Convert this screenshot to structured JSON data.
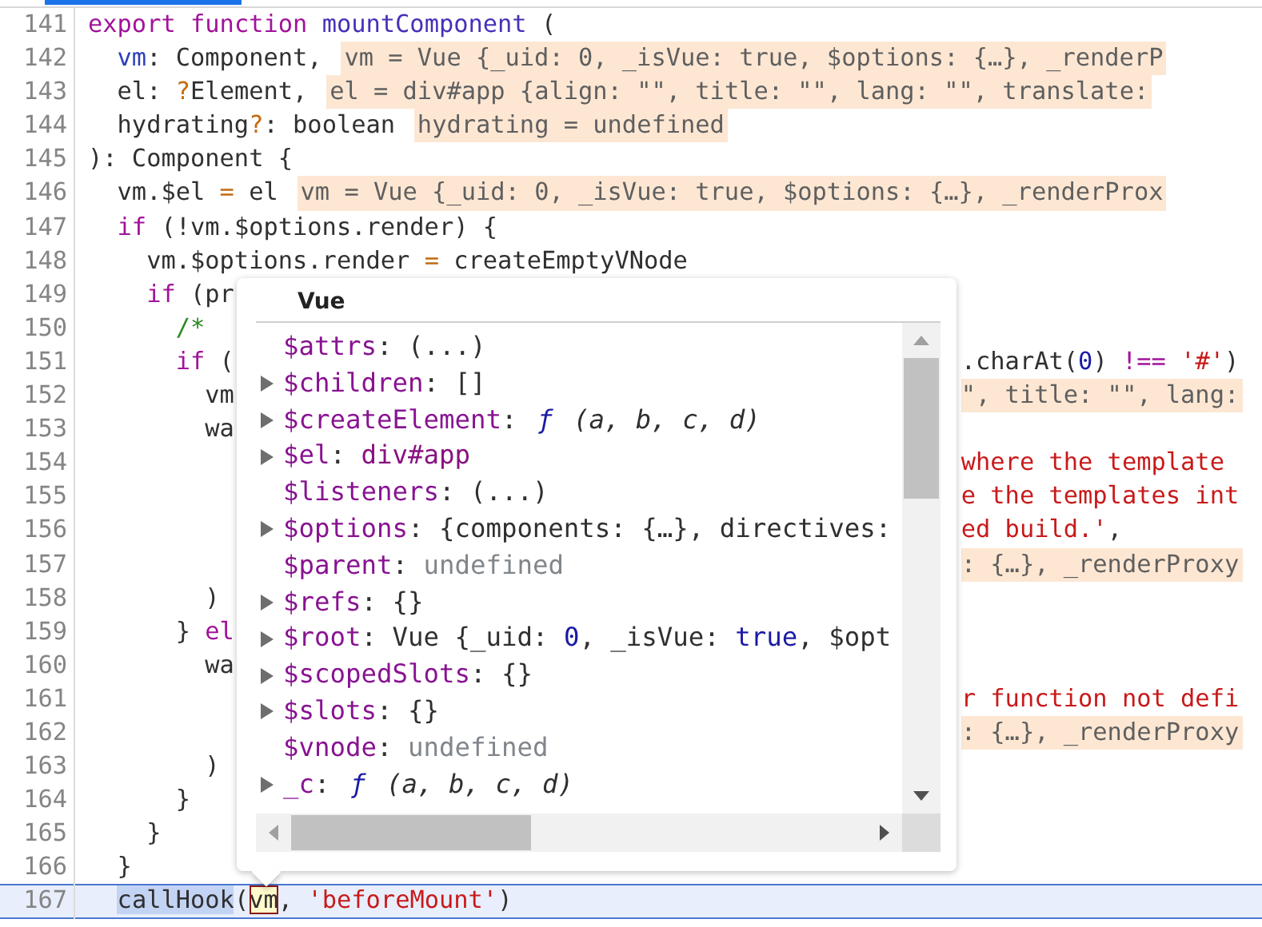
{
  "editor": {
    "lines": [
      {
        "number": "141",
        "current": false,
        "left": [
          {
            "kind": "code",
            "tokens": [
              {
                "kind": "keyword",
                "text": "export "
              },
              {
                "kind": "keyword",
                "text": "function "
              },
              {
                "kind": "def",
                "text": "mountComponent"
              },
              {
                "kind": "plain",
                "text": " ("
              }
            ]
          }
        ]
      },
      {
        "number": "142",
        "current": false,
        "left": [
          {
            "kind": "code",
            "tokens": [
              {
                "kind": "variable",
                "text": "  vm"
              },
              {
                "kind": "plain",
                "text": ": Component,"
              }
            ]
          },
          {
            "kind": "inline-value",
            "text": "vm = Vue {_uid: 0, _isVue: true, $options: {…}, _renderP"
          }
        ]
      },
      {
        "number": "143",
        "current": false,
        "left": [
          {
            "kind": "code",
            "tokens": [
              {
                "kind": "plain",
                "text": "  el: "
              },
              {
                "kind": "operator",
                "text": "?"
              },
              {
                "kind": "plain",
                "text": "Element,"
              }
            ]
          },
          {
            "kind": "inline-value",
            "text": "el = div#app {align: \"\", title: \"\", lang: \"\", translate:"
          }
        ]
      },
      {
        "number": "144",
        "current": false,
        "left": [
          {
            "kind": "code",
            "tokens": [
              {
                "kind": "plain",
                "text": "  hydrating"
              },
              {
                "kind": "operator",
                "text": "?"
              },
              {
                "kind": "plain",
                "text": ": boolean"
              }
            ]
          },
          {
            "kind": "inline-value",
            "text": "hydrating = undefined"
          }
        ]
      },
      {
        "number": "145",
        "current": false,
        "left": [
          {
            "kind": "code",
            "tokens": [
              {
                "kind": "plain",
                "text": "): Component {"
              }
            ]
          }
        ]
      },
      {
        "number": "146",
        "current": false,
        "left": [
          {
            "kind": "code",
            "tokens": [
              {
                "kind": "plain",
                "text": "  vm.$el "
              },
              {
                "kind": "operator",
                "text": "="
              },
              {
                "kind": "plain",
                "text": " el"
              }
            ]
          },
          {
            "kind": "inline-value",
            "text": "vm = Vue {_uid: 0, _isVue: true, $options: {…}, _renderProx"
          }
        ]
      },
      {
        "number": "147",
        "current": false,
        "left": [
          {
            "kind": "code",
            "tokens": [
              {
                "kind": "keyword",
                "text": "  if"
              },
              {
                "kind": "plain",
                "text": " (!vm.$options.render) {"
              }
            ]
          }
        ]
      },
      {
        "number": "148",
        "current": false,
        "left": [
          {
            "kind": "code",
            "tokens": [
              {
                "kind": "plain",
                "text": "    vm.$options.render "
              },
              {
                "kind": "operator",
                "text": "="
              },
              {
                "kind": "plain",
                "text": " createEmptyVNode"
              }
            ]
          }
        ]
      },
      {
        "number": "149",
        "current": false,
        "left": [
          {
            "kind": "code",
            "tokens": [
              {
                "kind": "keyword",
                "text": "    if"
              },
              {
                "kind": "plain",
                "text": " (pr"
              }
            ]
          }
        ]
      },
      {
        "number": "150",
        "current": false,
        "left": [
          {
            "kind": "code",
            "tokens": [
              {
                "kind": "comment",
                "text": "      /*"
              }
            ]
          }
        ]
      },
      {
        "number": "151",
        "current": false,
        "left": [
          {
            "kind": "code",
            "tokens": [
              {
                "kind": "keyword",
                "text": "      if"
              },
              {
                "kind": "plain",
                "text": " ("
              }
            ]
          }
        ],
        "right": [
          {
            "kind": "code",
            "tokens": [
              {
                "kind": "plain",
                "text": ".charAt("
              },
              {
                "kind": "number",
                "text": "0"
              },
              {
                "kind": "plain",
                "text": ") "
              },
              {
                "kind": "keyword",
                "text": "!=="
              },
              {
                "kind": "string",
                "text": " '#'"
              },
              {
                "kind": "plain",
                "text": ")"
              }
            ]
          }
        ]
      },
      {
        "number": "152",
        "current": false,
        "left": [
          {
            "kind": "code",
            "tokens": [
              {
                "kind": "plain",
                "text": "        vm"
              }
            ]
          }
        ],
        "right": [
          {
            "kind": "inline-value",
            "text": "\", title: \"\", lang:"
          }
        ]
      },
      {
        "number": "153",
        "current": false,
        "left": [
          {
            "kind": "code",
            "tokens": [
              {
                "kind": "plain",
                "text": "        wa"
              }
            ]
          }
        ]
      },
      {
        "number": "154",
        "current": false,
        "right": [
          {
            "kind": "code",
            "tokens": [
              {
                "kind": "string",
                "text": "where the template"
              }
            ]
          }
        ]
      },
      {
        "number": "155",
        "current": false,
        "right": [
          {
            "kind": "code",
            "tokens": [
              {
                "kind": "string",
                "text": "e the templates int"
              }
            ]
          }
        ]
      },
      {
        "number": "156",
        "current": false,
        "right": [
          {
            "kind": "code",
            "tokens": [
              {
                "kind": "string",
                "text": "ed build.'"
              },
              {
                "kind": "plain",
                "text": ","
              }
            ]
          }
        ]
      },
      {
        "number": "157",
        "current": false,
        "right": [
          {
            "kind": "inline-value",
            "text": ": {…}, _renderProxy"
          }
        ]
      },
      {
        "number": "158",
        "current": false,
        "left": [
          {
            "kind": "code",
            "tokens": [
              {
                "kind": "plain",
                "text": "        )"
              }
            ]
          }
        ]
      },
      {
        "number": "159",
        "current": false,
        "left": [
          {
            "kind": "code",
            "tokens": [
              {
                "kind": "plain",
                "text": "      } "
              },
              {
                "kind": "keyword",
                "text": "el"
              }
            ]
          }
        ]
      },
      {
        "number": "160",
        "current": false,
        "left": [
          {
            "kind": "code",
            "tokens": [
              {
                "kind": "plain",
                "text": "        wa"
              }
            ]
          }
        ]
      },
      {
        "number": "161",
        "current": false,
        "right": [
          {
            "kind": "code",
            "tokens": [
              {
                "kind": "string",
                "text": "r function not defi"
              }
            ]
          }
        ]
      },
      {
        "number": "162",
        "current": false,
        "right": [
          {
            "kind": "inline-value",
            "text": ": {…}, _renderProxy"
          }
        ]
      },
      {
        "number": "163",
        "current": false,
        "left": [
          {
            "kind": "code",
            "tokens": [
              {
                "kind": "plain",
                "text": "        )"
              }
            ]
          }
        ]
      },
      {
        "number": "164",
        "current": false,
        "left": [
          {
            "kind": "code",
            "tokens": [
              {
                "kind": "plain",
                "text": "      }"
              }
            ]
          }
        ]
      },
      {
        "number": "165",
        "current": false,
        "left": [
          {
            "kind": "code",
            "tokens": [
              {
                "kind": "plain",
                "text": "    }"
              }
            ]
          }
        ]
      },
      {
        "number": "166",
        "current": false,
        "left": [
          {
            "kind": "code",
            "tokens": [
              {
                "kind": "plain",
                "text": "  }"
              }
            ]
          }
        ]
      },
      {
        "number": "167",
        "current": true,
        "left": [
          {
            "kind": "code",
            "tokens": [
              {
                "kind": "selection",
                "text": "  callHook"
              },
              {
                "kind": "plain",
                "text": "("
              },
              {
                "kind": "hover",
                "text": "vm"
              },
              {
                "kind": "plain",
                "text": ", "
              },
              {
                "kind": "string",
                "text": "'beforeMount'"
              },
              {
                "kind": "plain",
                "text": ")"
              }
            ]
          }
        ]
      }
    ]
  },
  "popover": {
    "title": "Vue",
    "properties": [
      {
        "expandable": false,
        "key": "$attrs",
        "value": [
          {
            "kind": "plain",
            "text": ": (...)"
          }
        ]
      },
      {
        "expandable": true,
        "key": "$children",
        "value": [
          {
            "kind": "plain",
            "text": ": []"
          }
        ]
      },
      {
        "expandable": true,
        "key": "$createElement",
        "value": [
          {
            "kind": "plain",
            "text": ": "
          },
          {
            "kind": "function",
            "text": "ƒ"
          },
          {
            "kind": "italic",
            "text": " (a, b, c, d)"
          }
        ]
      },
      {
        "expandable": true,
        "key": "$el",
        "value": [
          {
            "kind": "plain",
            "text": ": "
          },
          {
            "kind": "element",
            "text": "div#app"
          }
        ]
      },
      {
        "expandable": false,
        "key": "$listeners",
        "value": [
          {
            "kind": "plain",
            "text": ": (...)"
          }
        ]
      },
      {
        "expandable": true,
        "key": "$options",
        "value": [
          {
            "kind": "plain",
            "text": ": {components: {…}, directives:"
          }
        ]
      },
      {
        "expandable": false,
        "key": "$parent",
        "value": [
          {
            "kind": "plain",
            "text": ": "
          },
          {
            "kind": "dim",
            "text": "undefined"
          }
        ]
      },
      {
        "expandable": true,
        "key": "$refs",
        "value": [
          {
            "kind": "plain",
            "text": ": {}"
          }
        ]
      },
      {
        "expandable": true,
        "key": "$root",
        "value": [
          {
            "kind": "plain",
            "text": ": Vue {_uid: "
          },
          {
            "kind": "number",
            "text": "0"
          },
          {
            "kind": "plain",
            "text": ", _isVue: "
          },
          {
            "kind": "number",
            "text": "true"
          },
          {
            "kind": "plain",
            "text": ", $opt"
          }
        ]
      },
      {
        "expandable": true,
        "key": "$scopedSlots",
        "value": [
          {
            "kind": "plain",
            "text": ": {}"
          }
        ]
      },
      {
        "expandable": true,
        "key": "$slots",
        "value": [
          {
            "kind": "plain",
            "text": ": {}"
          }
        ]
      },
      {
        "expandable": false,
        "key": "$vnode",
        "value": [
          {
            "kind": "plain",
            "text": ": "
          },
          {
            "kind": "dim",
            "text": "undefined"
          }
        ]
      },
      {
        "expandable": true,
        "key": "_c",
        "value": [
          {
            "kind": "plain",
            "text": ": "
          },
          {
            "kind": "function",
            "text": "ƒ"
          },
          {
            "kind": "italic",
            "text": " (a, b, c, d)"
          }
        ]
      }
    ]
  }
}
